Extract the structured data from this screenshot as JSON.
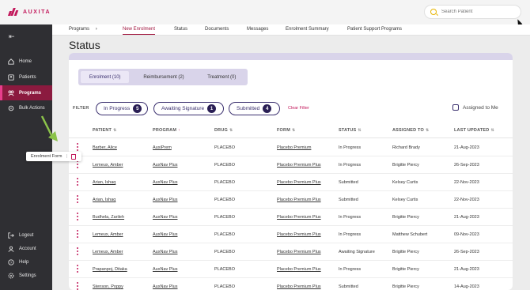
{
  "app": {
    "logo_text": "AUXITA",
    "brand_color": "#c2185b",
    "accent_color": "#3a2f6e"
  },
  "search": {
    "placeholder": "Search Patient"
  },
  "sidebar": {
    "items": [
      {
        "label": "Home",
        "icon": "home-icon"
      },
      {
        "label": "Patients",
        "icon": "patients-icon"
      },
      {
        "label": "Programs",
        "icon": "programs-icon",
        "active": true
      },
      {
        "label": "Bulk Actions",
        "icon": "bulk-actions-icon"
      }
    ],
    "bottom_items": [
      {
        "label": "Logout",
        "icon": "logout-icon"
      },
      {
        "label": "Account",
        "icon": "account-icon"
      },
      {
        "label": "Help",
        "icon": "help-icon"
      },
      {
        "label": "Settings",
        "icon": "settings-icon"
      }
    ]
  },
  "tabs": [
    {
      "label": "Programs"
    },
    {
      "label": "New Enrolment",
      "active": true
    },
    {
      "label": "Status"
    },
    {
      "label": "Documents"
    },
    {
      "label": "Messages"
    },
    {
      "label": "Enrolment Summary"
    },
    {
      "label": "Patient Support Programs"
    }
  ],
  "page": {
    "title": "Status"
  },
  "segments": [
    {
      "label": "Enrolment (10)",
      "active": true
    },
    {
      "label": "Reimbursement (2)"
    },
    {
      "label": "Treatment (0)"
    }
  ],
  "filter": {
    "label": "FILTER",
    "chips": [
      {
        "label": "In Progress",
        "count": "5"
      },
      {
        "label": "Awaiting Signature",
        "count": "1"
      },
      {
        "label": "Submitted",
        "count": "4"
      }
    ],
    "clear_label": "Clear Filter",
    "assigned_label": "Assigned to Me"
  },
  "table": {
    "headers": [
      "PATIENT",
      "PROGRAM",
      "DRUG",
      "FORM",
      "STATUS",
      "ASSIGNED TO",
      "LAST UPDATED"
    ],
    "rows": [
      [
        "Barber, Alice",
        "AuxiPrem",
        "PLACEBO",
        "Placebo Premium",
        "In Progress",
        "Richard Brady",
        "21-Aug-2023"
      ],
      [
        "Lemeux, Amber",
        "AuxNav Plus",
        "PLACEBO",
        "Placebo Premium Plus",
        "In Progress",
        "Brigitte Piercy",
        "26-Sep-2023"
      ],
      [
        "Arian, Ishaq",
        "AuxNav Plus",
        "PLACEBO",
        "Placebo Premium Plus",
        "Submitted",
        "Kelsey Curtis",
        "22-Nov-2023"
      ],
      [
        "Arian, Ishaq",
        "AuxNav Plus",
        "PLACEBO",
        "Placebo Premium Plus",
        "Submitted",
        "Kelsey Curtis",
        "22-Nov-2023"
      ],
      [
        "Budhela, Zarileh",
        "AuxNav Plus",
        "PLACEBO",
        "Placebo Premium Plus",
        "In Progress",
        "Brigitte Piercy",
        "21-Aug-2023"
      ],
      [
        "Lemeux, Amber",
        "AuxNav Plus",
        "PLACEBO",
        "Placebo Premium Plus",
        "In Progress",
        "Matthew Schubert",
        "09-Nov-2023"
      ],
      [
        "Lemeux, Amber",
        "AuxNav Plus",
        "PLACEBO",
        "Placebo Premium Plus",
        "Awaiting Signature",
        "Brigitte Piercy",
        "26-Sep-2023"
      ],
      [
        "Prapanpoj, Ditaka",
        "AuxNav Plus",
        "PLACEBO",
        "Placebo Premium Plus",
        "In Progress",
        "Brigitte Piercy",
        "21-Aug-2023"
      ],
      [
        "Stenson, Poppy",
        "AuxNav Plus",
        "PLACEBO",
        "Placebo Premium Plus",
        "Submitted",
        "Brigitte Piercy",
        "14-Aug-2023"
      ]
    ]
  },
  "tooltip": {
    "label": "Enrolment Form",
    "separator": "|"
  }
}
